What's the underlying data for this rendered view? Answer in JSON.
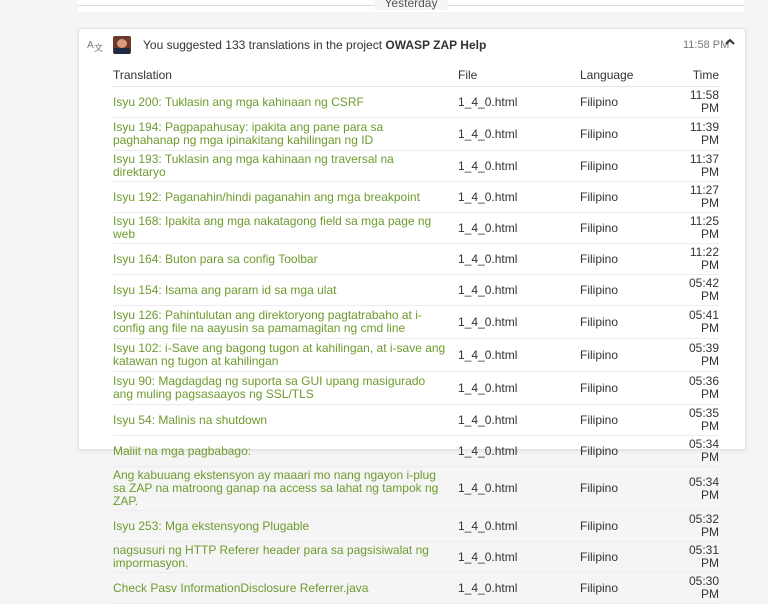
{
  "day_label": "Yesterday",
  "activity": {
    "summary_prefix": "You suggested 133 translations in the project ",
    "project": "OWASP ZAP Help",
    "time": "11:58 PM",
    "icon": "translate-icon",
    "collapse_icon": "chevron-up-icon"
  },
  "table": {
    "headers": {
      "translation": "Translation",
      "file": "File",
      "language": "Language",
      "time": "Time"
    },
    "rows": [
      {
        "translation": "Isyu 200: Tuklasin ang mga kahinaan ng CSRF",
        "file": "1_4_0.html",
        "language": "Filipino",
        "time": "11:58 PM"
      },
      {
        "translation": "Isyu 194: Pagpapahusay: ipakita ang pane para sa paghahanap ng mga ipinakitang kahilingan ng ID",
        "file": "1_4_0.html",
        "language": "Filipino",
        "time": "11:39 PM"
      },
      {
        "translation": "Isyu 193: Tuklasin ang mga kahinaan ng traversal na direktaryo",
        "file": "1_4_0.html",
        "language": "Filipino",
        "time": "11:37 PM"
      },
      {
        "translation": "Isyu 192: Paganahin/hindi paganahin ang mga breakpoint",
        "file": "1_4_0.html",
        "language": "Filipino",
        "time": "11:27 PM"
      },
      {
        "translation": "Isyu 168: Ipakita ang mga nakatagong field sa mga page ng web",
        "file": "1_4_0.html",
        "language": "Filipino",
        "time": "11:25 PM"
      },
      {
        "translation": "Isyu 164: Buton para sa config Toolbar",
        "file": "1_4_0.html",
        "language": "Filipino",
        "time": "11:22 PM"
      },
      {
        "translation": "Isyu 154: Isama ang param id sa mga ulat",
        "file": "1_4_0.html",
        "language": "Filipino",
        "time": "05:42 PM"
      },
      {
        "translation": "Isyu 126: Pahintulutan ang direktoryong pagtatrabaho at i-config ang file na aayusin sa pamamagitan ng cmd line",
        "file": "1_4_0.html",
        "language": "Filipino",
        "time": "05:41 PM"
      },
      {
        "translation": "Isyu 102: i-Save ang bagong tugon at kahilingan, at i-save ang katawan ng tugon at kahilingan",
        "file": "1_4_0.html",
        "language": "Filipino",
        "time": "05:39 PM"
      },
      {
        "translation": "Isyu 90: Magdagdag ng suporta sa GUI upang masigurado ang muling pagsasaayos ng SSL/TLS",
        "file": "1_4_0.html",
        "language": "Filipino",
        "time": "05:36 PM"
      },
      {
        "translation": "Isyu 54: Malinis na shutdown",
        "file": "1_4_0.html",
        "language": "Filipino",
        "time": "05:35 PM"
      },
      {
        "translation": "Maliit na mga pagbabago:",
        "file": "1_4_0.html",
        "language": "Filipino",
        "time": "05:34 PM"
      },
      {
        "translation": "Ang kabuuang ekstensyon ay maaari mo nang ngayon i-plug sa ZAP na matroong ganap na access sa lahat ng tampok ng ZAP.",
        "file": "1_4_0.html",
        "language": "Filipino",
        "time": "05:34 PM"
      },
      {
        "translation": "Isyu 253: Mga ekstensyong Plugable",
        "file": "1_4_0.html",
        "language": "Filipino",
        "time": "05:32 PM"
      },
      {
        "translation": "nagsusuri ng HTTP Referer header para sa pagsisiwalat ng impormasyon.",
        "file": "1_4_0.html",
        "language": "Filipino",
        "time": "05:31 PM"
      },
      {
        "translation": "Check Pasv InformationDisclosure Referrer.java",
        "file": "1_4_0.html",
        "language": "Filipino",
        "time": "05:30 PM"
      }
    ]
  }
}
